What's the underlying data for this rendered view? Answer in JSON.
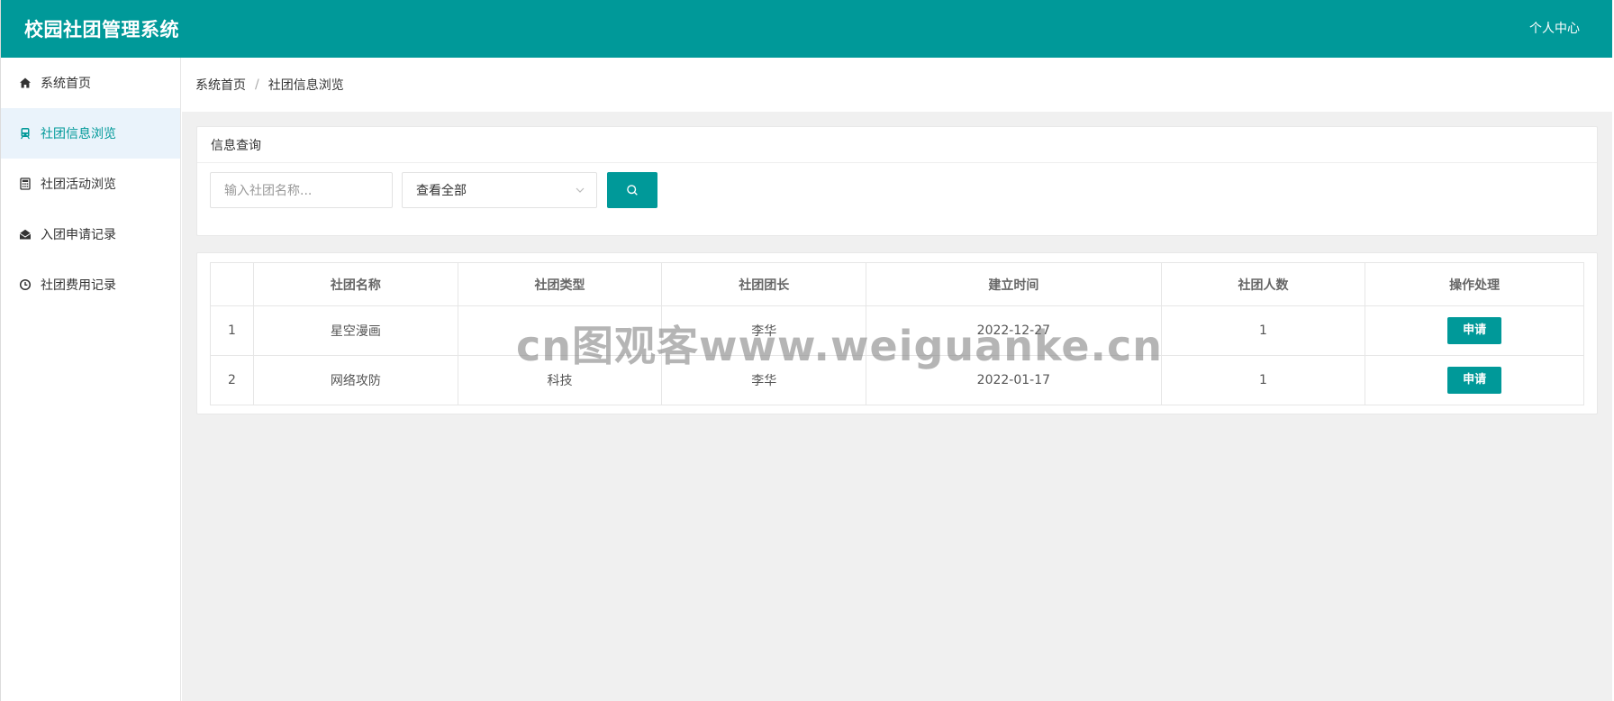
{
  "header": {
    "title": "校园社团管理系统",
    "user_menu": "个人中心"
  },
  "sidebar": {
    "items": [
      {
        "label": "系统首页",
        "icon": "home-icon",
        "active": false
      },
      {
        "label": "社团信息浏览",
        "icon": "train-icon",
        "active": true
      },
      {
        "label": "社团活动浏览",
        "icon": "calculator-icon",
        "active": false
      },
      {
        "label": "入团申请记录",
        "icon": "envelope-open-icon",
        "active": false
      },
      {
        "label": "社团费用记录",
        "icon": "clock-icon",
        "active": false
      }
    ]
  },
  "breadcrumb": {
    "home": "系统首页",
    "separator": "/",
    "current": "社团信息浏览"
  },
  "query": {
    "title": "信息查询",
    "name_placeholder": "输入社团名称...",
    "type_select": "查看全部"
  },
  "table": {
    "headers": [
      "",
      "社团名称",
      "社团类型",
      "社团团长",
      "建立时间",
      "社团人数",
      "操作处理"
    ],
    "rows": [
      {
        "index": "1",
        "name": "星空漫画",
        "type": "",
        "leader": "李华",
        "date": "2022-12-27",
        "members": "1",
        "action": "申请"
      },
      {
        "index": "2",
        "name": "网络攻防",
        "type": "科技",
        "leader": "李华",
        "date": "2022-01-17",
        "members": "1",
        "action": "申请"
      }
    ]
  },
  "watermark": "cn图观客www.weiguanke.cn",
  "colors": {
    "primary": "#009999",
    "active_bg": "#eaf3fb",
    "content_bg": "#f0f0f0"
  }
}
